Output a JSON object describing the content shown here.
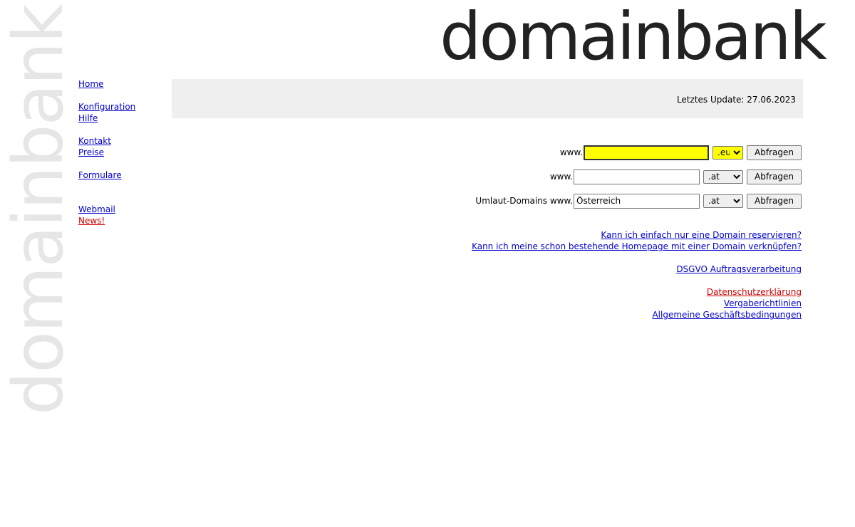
{
  "brand": {
    "name": "domainbank",
    "side_name": "domainbank"
  },
  "nav": {
    "home": "Home",
    "konfiguration": "Konfiguration",
    "hilfe": "Hilfe",
    "kontakt": "Kontakt",
    "preise": "Preise",
    "formulare": "Formulare",
    "webmail": "Webmail",
    "news": "News!"
  },
  "update": {
    "text": "Letztes Update: 27.06.2023"
  },
  "search": {
    "row1": {
      "prefix": "www.",
      "value": "",
      "tld": ".eu",
      "button": "Abfragen"
    },
    "row2": {
      "prefix": "www.",
      "value": "",
      "tld": ".at",
      "button": "Abfragen"
    },
    "row3": {
      "prefix": "Umlaut-Domains www.",
      "value": "Österreich",
      "tld": ".at",
      "button": "Abfragen"
    }
  },
  "links": {
    "reserve": "Kann ich einfach nur eine Domain reservieren?",
    "connect": "Kann ich meine schon bestehende Homepage mit einer Domain verknüpfen?",
    "dsgvo": "DSGVO Auftragsverarbeitung",
    "privacy": "Datenschutzerklärung",
    "guidelines": "Vergaberichtlinien",
    "terms": "Allgemeine Geschäftsbedingungen"
  },
  "colors": {
    "link": "#0000cc",
    "highlight_link": "#cc0000",
    "input_highlight": "#ffff00",
    "bar": "#efefef"
  }
}
